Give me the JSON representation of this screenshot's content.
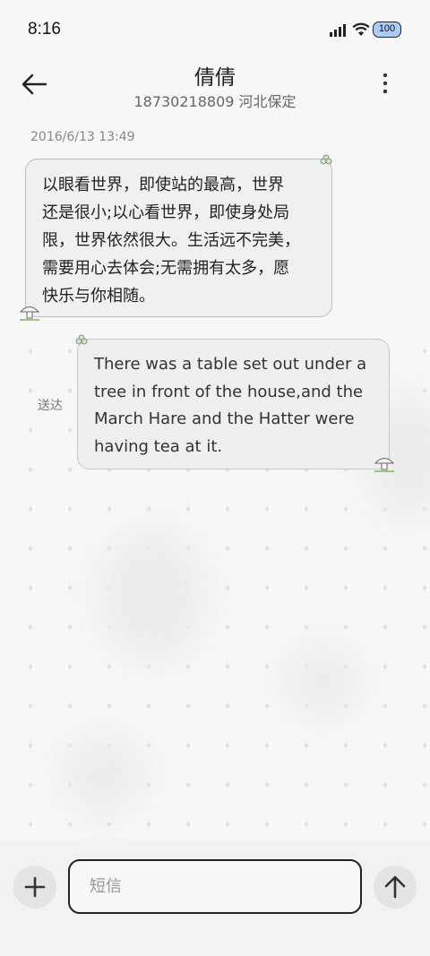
{
  "status_bar": {
    "time": "8:16",
    "battery": "100"
  },
  "header": {
    "contact_name": "倩倩",
    "contact_info": "18730218809 河北保定"
  },
  "messages": [
    {
      "direction": "incoming",
      "timestamp": "2016/6/13 13:49",
      "text": "以眼看世界，即使站的最高，世界还是很小;以心看世界，即使身处局限，世界依然很大。生活远不完美，需要用心去体会;无需拥有太多，愿快乐与你相随。",
      "lines": [
        "以眼看世界，即使站的最高，世界",
        "还是很小;以心看世界，即使身处局",
        "限，世界依然很大。生活远不完美，",
        "需要用心去体会;无需拥有太多，愿",
        "快乐与你相随。"
      ]
    },
    {
      "direction": "outgoing",
      "status": "送达",
      "text": "There was a table set out under a tree in front of the house,and the March Hare and the Hatter were having tea at it.",
      "lines": [
        "There was a table set out under a",
        "tree in front of the house,and the",
        "March Hare and the Hatter were",
        "having tea at it."
      ]
    }
  ],
  "composer": {
    "placeholder": "短信"
  },
  "icons": {
    "back": "arrow-left-icon",
    "more": "more-vertical-icon",
    "add": "plus-icon",
    "send": "arrow-up-icon"
  }
}
